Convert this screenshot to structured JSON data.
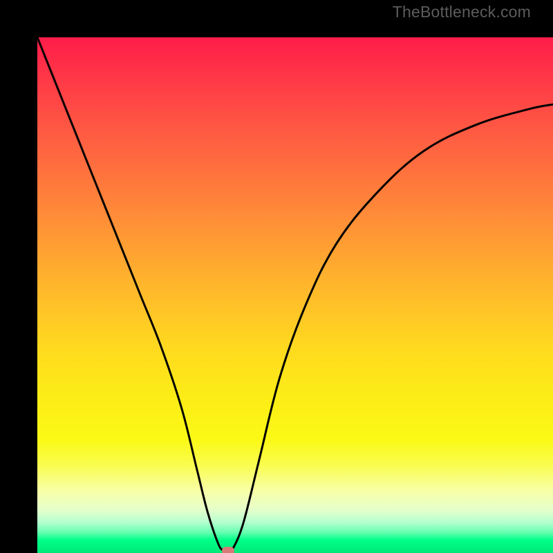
{
  "watermark": "TheBottleneck.com",
  "chart_data": {
    "type": "line",
    "title": "",
    "xlabel": "",
    "ylabel": "",
    "xlim": [
      0,
      100
    ],
    "ylim": [
      0,
      100
    ],
    "gradient_meaning": "background ranges from red (high bottleneck) at top to green (low bottleneck) at bottom",
    "minimum_point": {
      "x": 37,
      "y": 0
    },
    "series": [
      {
        "name": "bottleneck-curve",
        "x": [
          0,
          4,
          8,
          12,
          16,
          20,
          24,
          28,
          31,
          33,
          35,
          36,
          37,
          38,
          40,
          43,
          47,
          52,
          58,
          66,
          75,
          85,
          95,
          100
        ],
        "values": [
          100,
          90,
          80,
          70,
          60,
          50,
          40,
          28,
          16,
          8,
          2,
          0.5,
          0.2,
          1,
          6,
          18,
          34,
          48,
          60,
          70,
          78,
          83,
          86,
          87
        ]
      }
    ]
  }
}
